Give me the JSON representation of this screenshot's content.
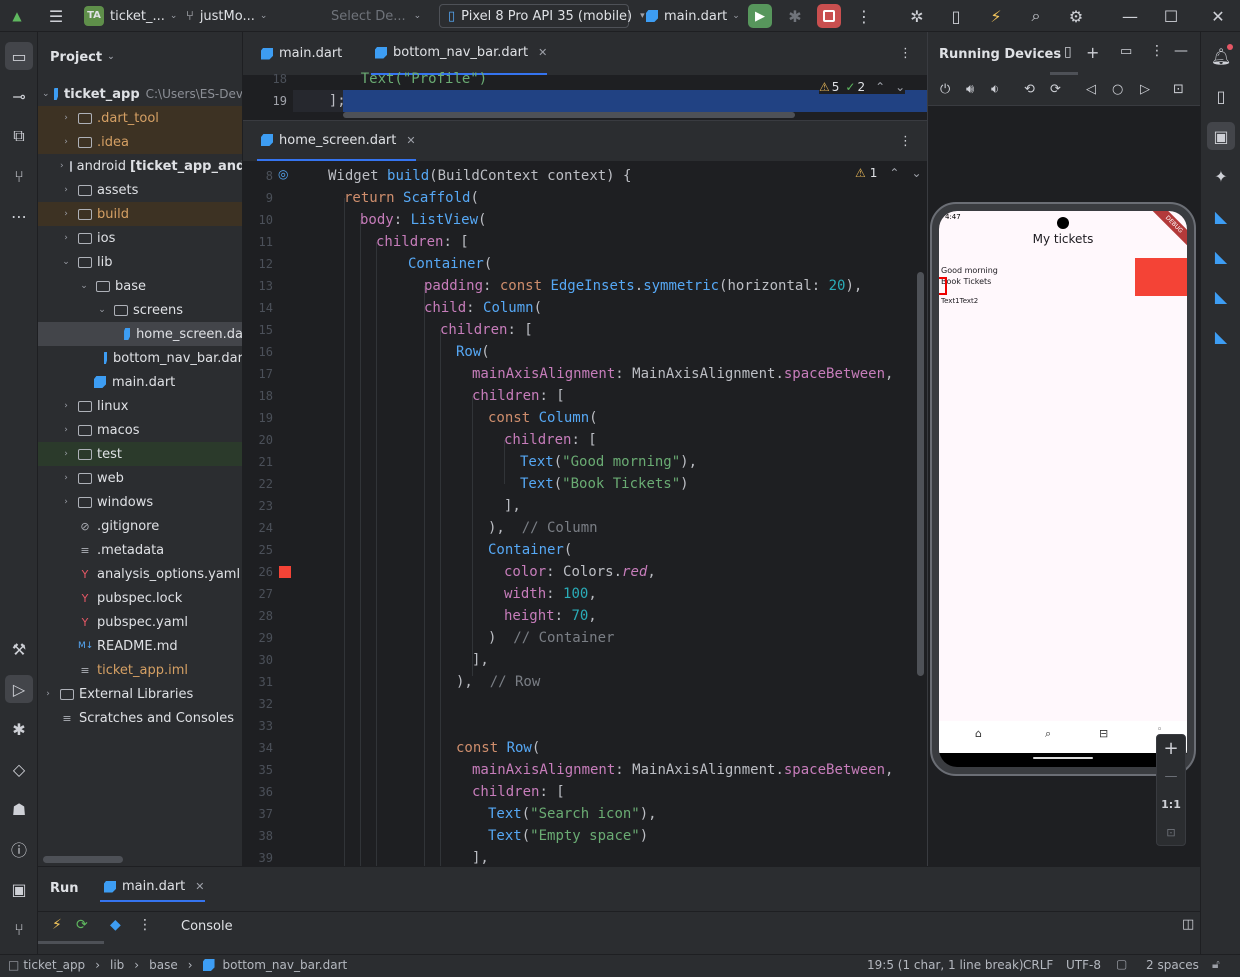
{
  "titlebar": {
    "project_badge": "TA",
    "project_name": "ticket_...",
    "vcs_branch": "justMo...",
    "config_selector": "Select De...",
    "device_selector": "Pixel 8 Pro API 35 (mobile)",
    "run_config": "main.dart"
  },
  "project_panel": {
    "title": "Project",
    "root_name": "ticket_app",
    "root_path": "C:\\Users\\ES-Dev",
    "items": [
      {
        "label": ".dart_tool",
        "depth": 1
      },
      {
        "label": ".idea",
        "depth": 1
      },
      {
        "label": "android",
        "suffix": "[ticket_app_andr",
        "depth": 1
      },
      {
        "label": "assets",
        "depth": 1
      },
      {
        "label": "build",
        "depth": 1
      },
      {
        "label": "ios",
        "depth": 1
      },
      {
        "label": "lib",
        "depth": 1
      },
      {
        "label": "base",
        "depth": 2
      },
      {
        "label": "screens",
        "depth": 3
      },
      {
        "label": "home_screen.da",
        "depth": 4
      },
      {
        "label": "bottom_nav_bar.dar",
        "depth": 3
      },
      {
        "label": "main.dart",
        "depth": 2
      },
      {
        "label": "linux",
        "depth": 1
      },
      {
        "label": "macos",
        "depth": 1
      },
      {
        "label": "test",
        "depth": 1
      },
      {
        "label": "web",
        "depth": 1
      },
      {
        "label": "windows",
        "depth": 1
      },
      {
        "label": ".gitignore",
        "depth": 1
      },
      {
        "label": ".metadata",
        "depth": 1
      },
      {
        "label": "analysis_options.yaml",
        "depth": 1
      },
      {
        "label": "pubspec.lock",
        "depth": 1
      },
      {
        "label": "pubspec.yaml",
        "depth": 1
      },
      {
        "label": "README.md",
        "depth": 1
      },
      {
        "label": "ticket_app.iml",
        "depth": 1
      },
      {
        "label": "External Libraries",
        "depth": 0
      },
      {
        "label": "Scratches and Consoles",
        "depth": 0
      }
    ]
  },
  "top_editor": {
    "tabs": [
      "main.dart",
      "bottom_nav_bar.dart"
    ],
    "line_numbers": [
      "18",
      "19"
    ],
    "lines": [
      "    Text(\"Profile\")",
      "  ];"
    ],
    "warnings": "5",
    "checks": "2"
  },
  "bottom_editor": {
    "tab": "home_screen.dart",
    "warnings": "1",
    "line_numbers": [
      "8",
      "9",
      "10",
      "11",
      "12",
      "13",
      "14",
      "15",
      "16",
      "17",
      "18",
      "19",
      "20",
      "21",
      "22",
      "23",
      "24",
      "25",
      "26",
      "27",
      "28",
      "29",
      "30",
      "31",
      "32",
      "33",
      "34",
      "35",
      "36",
      "37",
      "38",
      "39"
    ]
  },
  "devices_panel": {
    "title": "Running Devices",
    "status_time": "4:47",
    "app_title": "My tickets",
    "text1": "Good morning",
    "text2": "Book Tickets",
    "text3": "Text1Text2",
    "debug_banner": "DEBUG",
    "zoom_label": "1:1",
    "box_color": "#f44336"
  },
  "run_panel": {
    "tab_run": "Run",
    "tab_file": "main.dart",
    "console": "Console"
  },
  "statusbar": {
    "crumbs": [
      "ticket_app",
      "lib",
      "base",
      "bottom_nav_bar.dart"
    ],
    "position": "19:5 (1 char, 1 line break)",
    "line_sep": "CRLF",
    "encoding": "UTF-8",
    "indent": "2 spaces"
  }
}
